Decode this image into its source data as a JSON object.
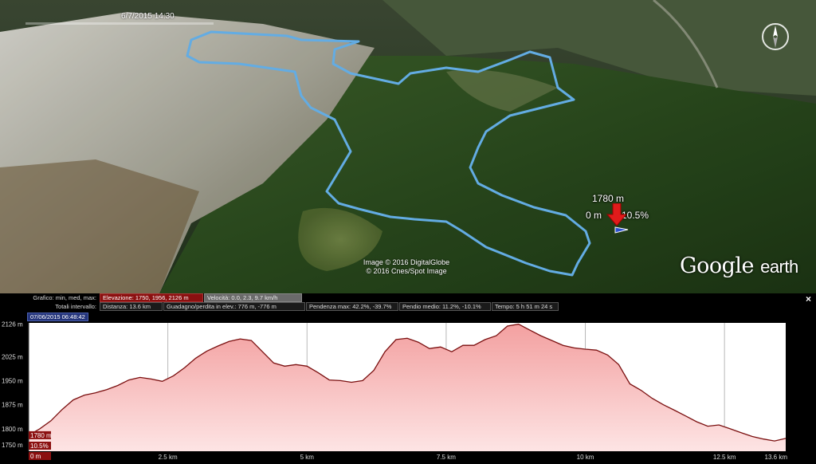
{
  "map": {
    "date": "6/7/2015 14:30",
    "marker_elevation": "1780 m",
    "marker_distance": "0 m",
    "marker_slope": "10.5%",
    "credit_line1": "Image © 2016 DigitalGlobe",
    "credit_line2": "© 2016 Cnes/Spot Image",
    "brand_main": "Google",
    "brand_sub": "earth"
  },
  "stats": {
    "row1_title": "Grafico: min, med, max:",
    "elevation": "Elevazione: 1750, 1956, 2126 m",
    "speed": "Velocità: 0.0, 2.3, 9.7 km/h",
    "row2_title": "Totali intervallo:",
    "distance": "Distanza: 13.6 km",
    "gain_loss": "Guadagno/perdita in elev.: 776 m, -776 m",
    "max_slope": "Pendenza max: 42.2%, -39.7%",
    "avg_slope": "Pendio medio: 11.2%, -10.1%",
    "time": "Tempo: 5 h 51 m 24 s",
    "timestamp": "07/06/2015 06:48:42",
    "close_label": "×"
  },
  "profile": {
    "y_labels": [
      "2126 m",
      "2025 m",
      "1950 m",
      "1875 m",
      "1800 m",
      "1750 m"
    ],
    "x_labels": [
      "2.5 km",
      "5 km",
      "7.5 km",
      "10 km",
      "12.5 km",
      "13.6 km"
    ],
    "cursor_elevation": "1780 m",
    "cursor_slope": "10.5%",
    "cursor_distance": "0 m"
  },
  "chart_data": {
    "type": "area",
    "xlabel": "",
    "ylabel": "",
    "xlim": [
      0,
      13.6
    ],
    "ylim": [
      1730,
      2130
    ],
    "x": [
      0,
      0.2,
      0.4,
      0.6,
      0.8,
      1.0,
      1.2,
      1.4,
      1.6,
      1.8,
      2.0,
      2.2,
      2.4,
      2.6,
      2.8,
      3.0,
      3.2,
      3.4,
      3.6,
      3.8,
      4.0,
      4.2,
      4.4,
      4.6,
      4.8,
      5.0,
      5.2,
      5.4,
      5.6,
      5.8,
      6.0,
      6.2,
      6.4,
      6.6,
      6.8,
      7.0,
      7.2,
      7.4,
      7.6,
      7.8,
      8.0,
      8.2,
      8.4,
      8.6,
      8.8,
      9.0,
      9.2,
      9.4,
      9.6,
      9.8,
      10.0,
      10.2,
      10.4,
      10.6,
      10.8,
      11.0,
      11.2,
      11.4,
      11.6,
      11.8,
      12.0,
      12.2,
      12.4,
      12.6,
      12.8,
      13.0,
      13.2,
      13.4,
      13.6
    ],
    "series": [
      {
        "values": [
          1780,
          1800,
          1825,
          1860,
          1890,
          1905,
          1912,
          1922,
          1935,
          1952,
          1960,
          1955,
          1948,
          1965,
          1990,
          2020,
          2042,
          2058,
          2072,
          2080,
          2075,
          2040,
          2005,
          1995,
          2000,
          1995,
          1975,
          1952,
          1950,
          1945,
          1950,
          1982,
          2040,
          2078,
          2082,
          2070,
          2050,
          2055,
          2040,
          2060,
          2060,
          2078,
          2090,
          2120,
          2126,
          2108,
          2090,
          2075,
          2060,
          2052,
          2048,
          2045,
          2030,
          2000,
          1940,
          1920,
          1895,
          1875,
          1858,
          1840,
          1822,
          1808,
          1812,
          1800,
          1788,
          1776,
          1768,
          1762,
          1770,
          1762,
          1768,
          1775,
          1770
        ]
      }
    ]
  }
}
